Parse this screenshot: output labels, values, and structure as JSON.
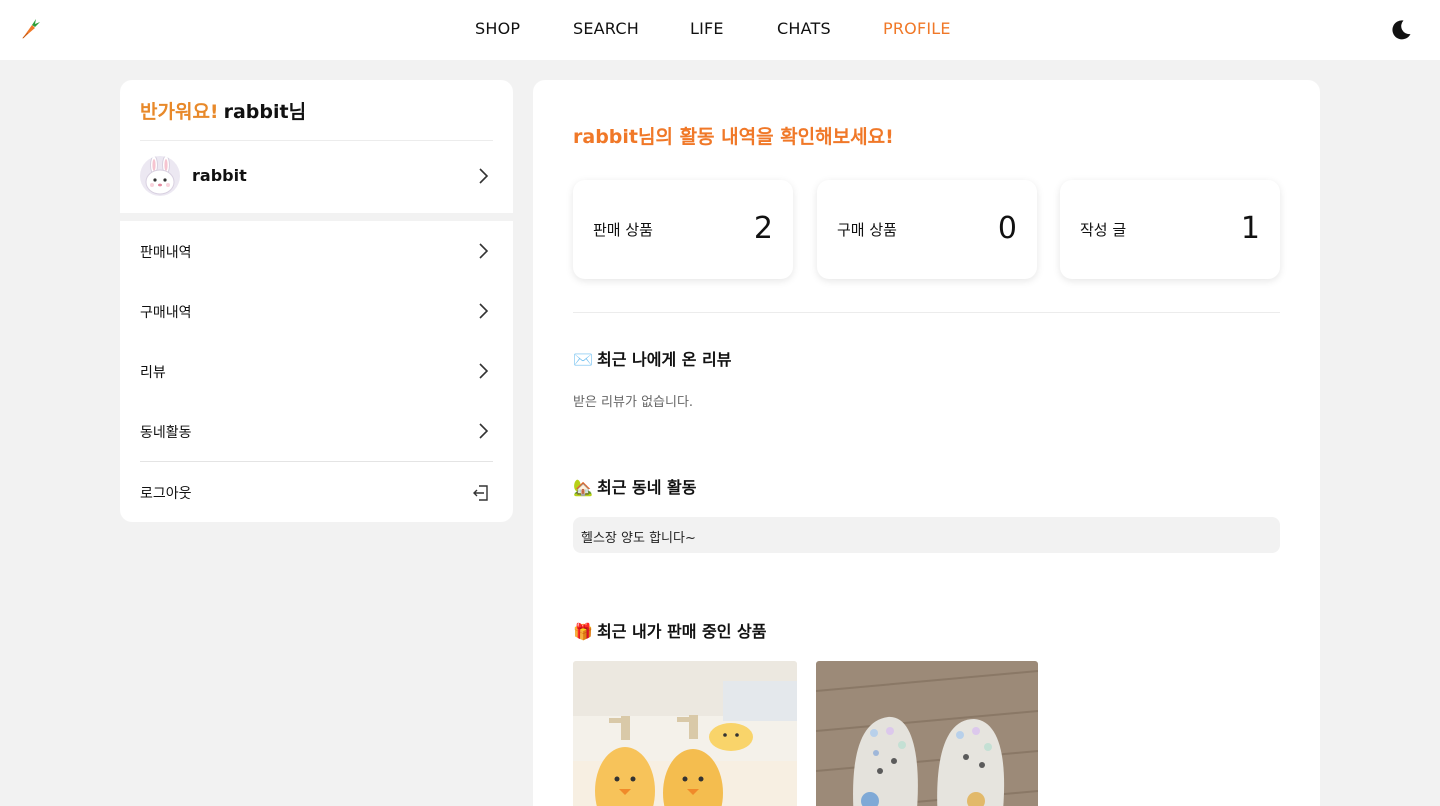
{
  "nav": {
    "logo_icon": "carrot-icon",
    "links": [
      {
        "label": "SHOP",
        "active": false
      },
      {
        "label": "SEARCH",
        "active": false
      },
      {
        "label": "LIFE",
        "active": false
      },
      {
        "label": "CHATS",
        "active": false
      },
      {
        "label": "PROFILE",
        "active": true
      }
    ],
    "theme_icon": "moon-icon"
  },
  "sidebar": {
    "greeting_hello": "반가워요!",
    "greeting_user": "rabbit님",
    "profile": {
      "name": "rabbit",
      "avatar_icon": "rabbit-avatar"
    },
    "menu": [
      {
        "label": "판매내역"
      },
      {
        "label": "구매내역"
      },
      {
        "label": "리뷰"
      },
      {
        "label": "동네활동"
      }
    ],
    "logout_label": "로그아웃"
  },
  "main": {
    "title": "rabbit님의 활동 내역을 확인해보세요!",
    "stats": [
      {
        "label": "판매 상품",
        "value": "2"
      },
      {
        "label": "구매 상품",
        "value": "0"
      },
      {
        "label": "작성 글",
        "value": "1"
      }
    ],
    "reviews": {
      "emoji": "✉️",
      "title": "최근 나에게 온 리뷰",
      "empty": "받은 리뷰가 없습니다."
    },
    "neighborhood": {
      "emoji": "🏡",
      "title": "최근 동네 활동",
      "posts": [
        "헬스장 양도 합니다~"
      ]
    },
    "selling": {
      "emoji": "🎁",
      "title": "최근 내가 판매 중인 상품"
    }
  },
  "colors": {
    "accent": "#f07828",
    "greeting": "#e8892a",
    "background": "#f2f2f2"
  }
}
